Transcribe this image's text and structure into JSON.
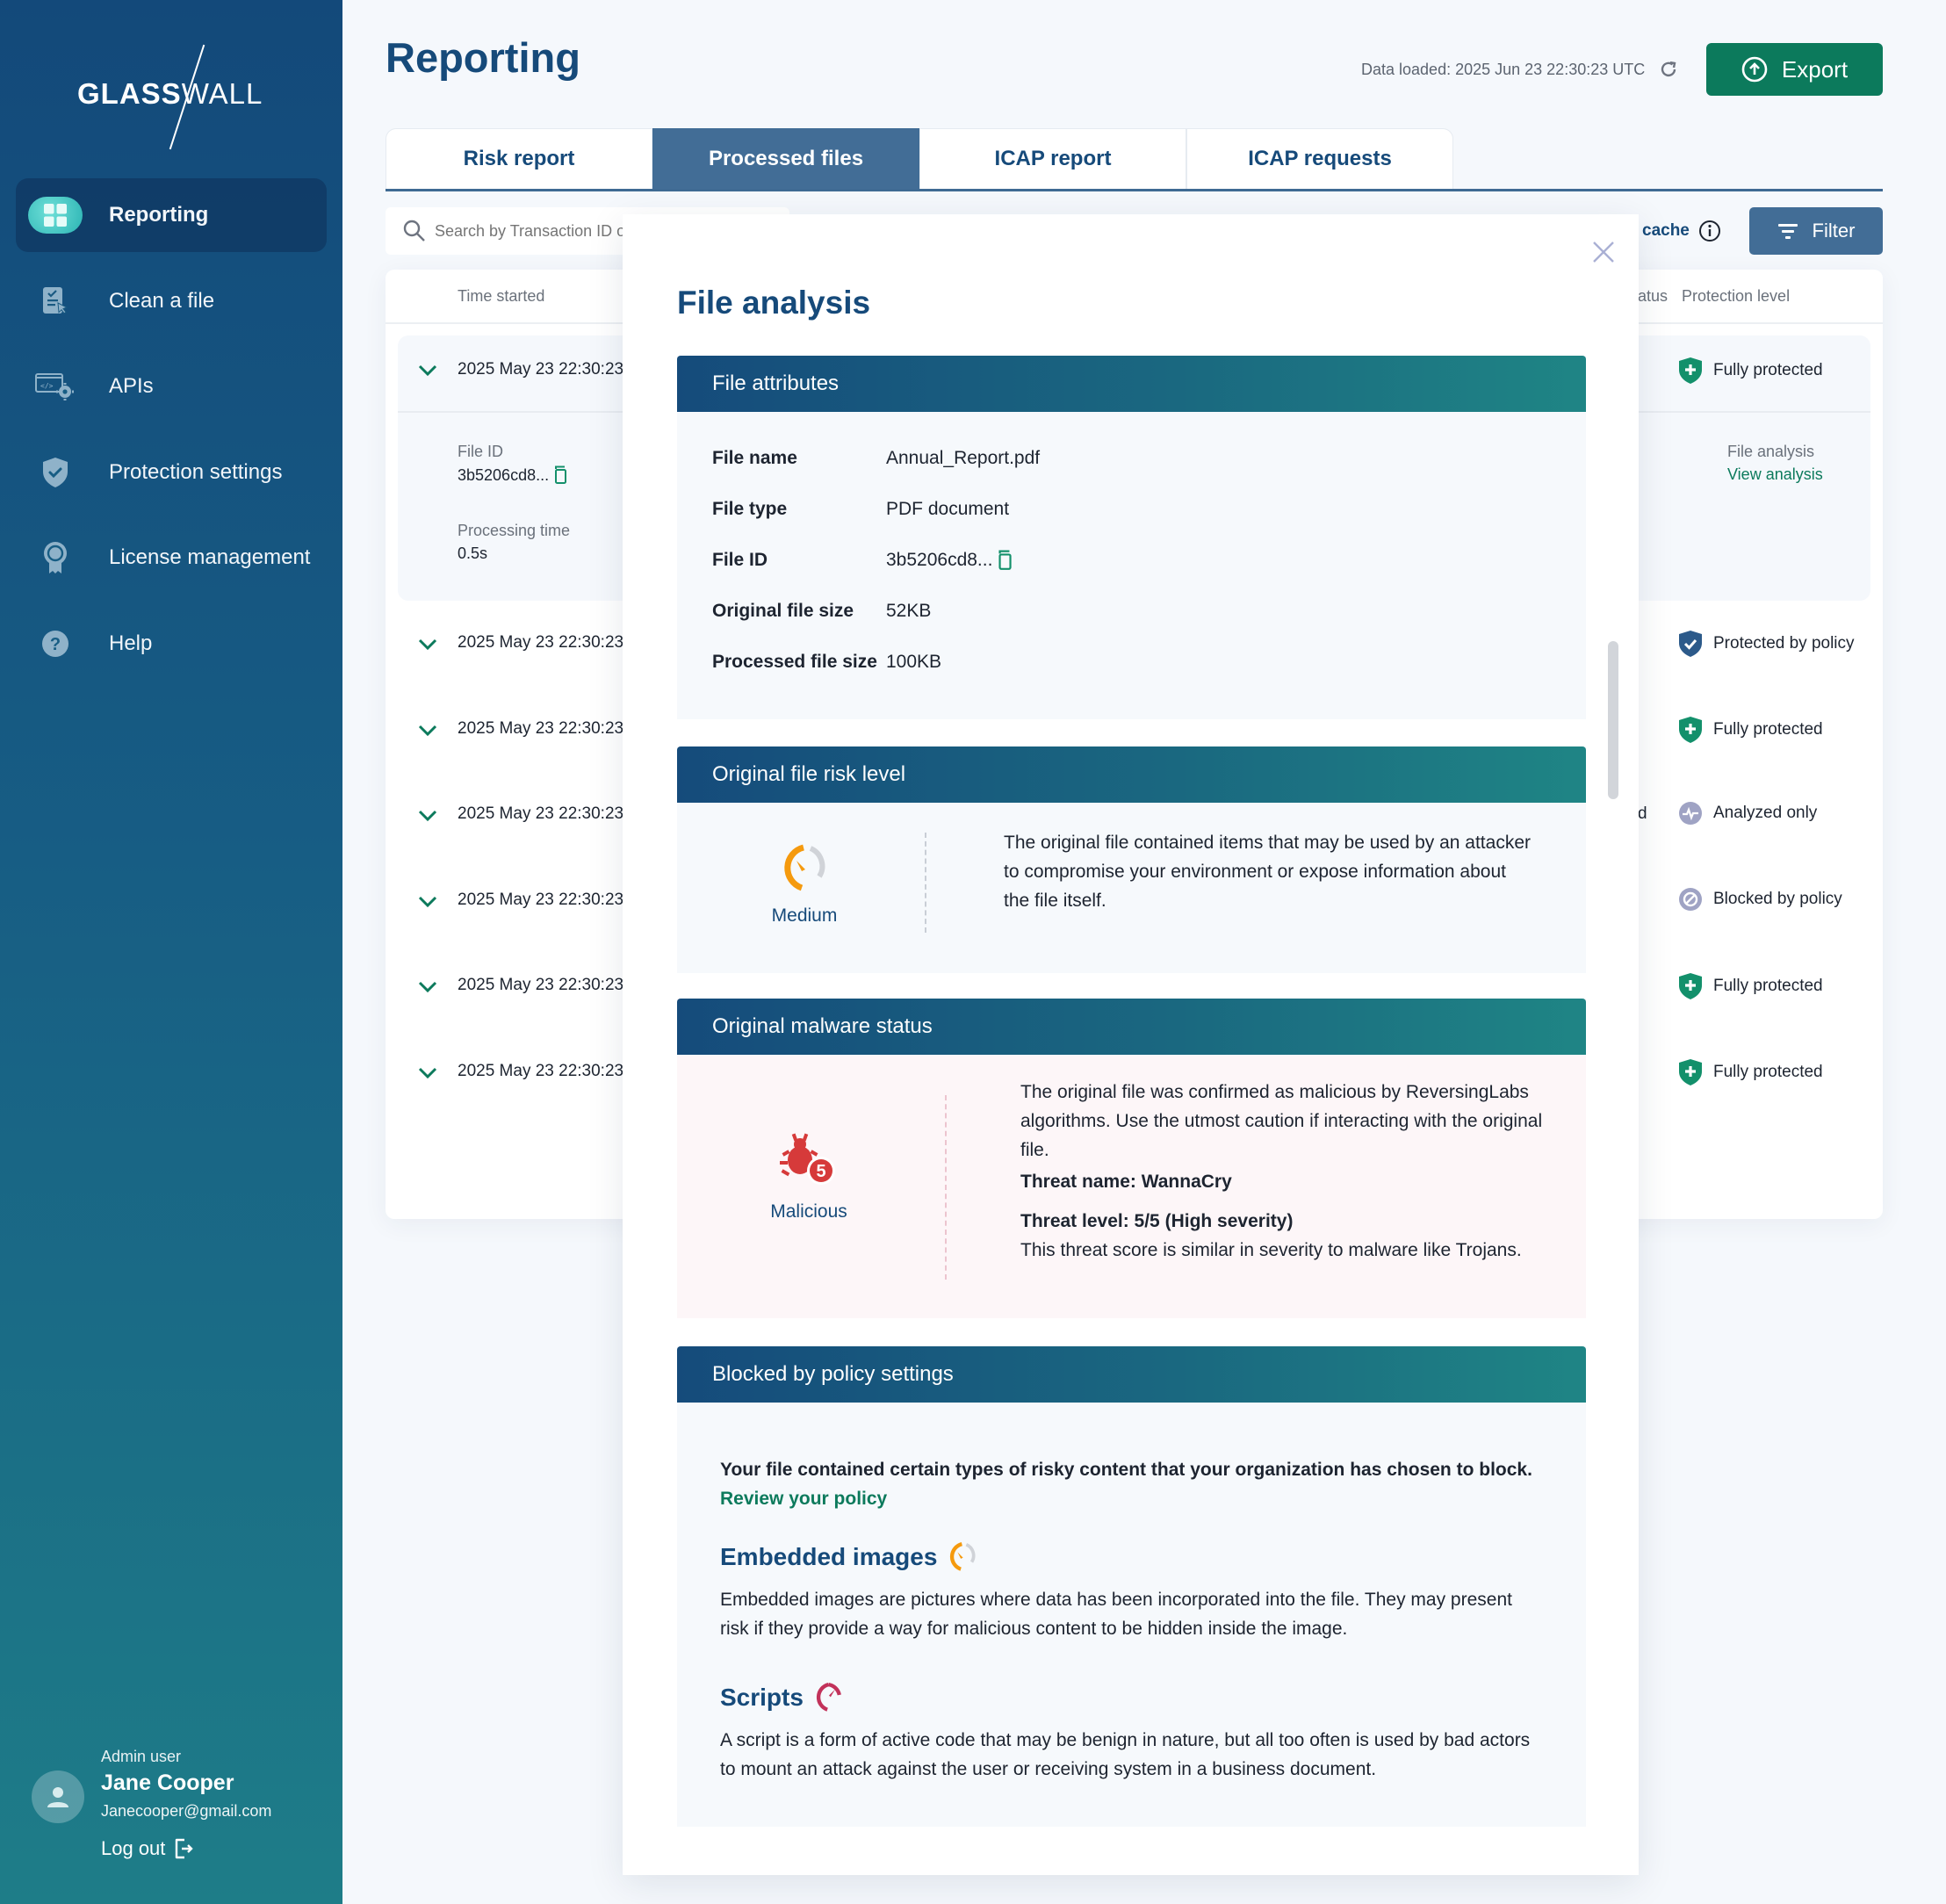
{
  "brand": {
    "name_bold": "GLASS",
    "name_light": "WALL"
  },
  "colors": {
    "primary": "#164a7a",
    "accent_green": "#0c7a5c",
    "tab_active": "#426d96",
    "medium_risk": "#f59a0e",
    "malicious": "#d63a3a",
    "high_risk": "#c2325a",
    "status_neutral": "#9fa3c4",
    "policy_blue": "#2c5a8a"
  },
  "sidebar": {
    "items": [
      {
        "label": "Reporting",
        "icon": "dashboard-grid-icon",
        "active": true
      },
      {
        "label": "Clean a file",
        "icon": "clean-file-icon",
        "active": false
      },
      {
        "label": "APIs",
        "icon": "api-settings-icon",
        "active": false
      },
      {
        "label": "Protection settings",
        "icon": "shield-check-icon",
        "active": false
      },
      {
        "label": "License management",
        "icon": "license-badge-icon",
        "active": false
      },
      {
        "label": "Help",
        "icon": "help-icon",
        "active": false
      }
    ],
    "user": {
      "role": "Admin user",
      "name": "Jane Cooper",
      "email": "Janecooper@gmail.com",
      "logout_label": "Log out"
    }
  },
  "header": {
    "title": "Reporting",
    "data_loaded": "Data loaded: 2025 Jun 23 22:30:23 UTC",
    "export_label": "Export"
  },
  "tabs": [
    {
      "label": "Risk report",
      "active": false
    },
    {
      "label": "Processed files",
      "active": true
    },
    {
      "label": "ICAP report",
      "active": false
    },
    {
      "label": "ICAP requests",
      "active": false
    }
  ],
  "toolbar": {
    "search_placeholder": "Search by Transaction ID o",
    "cache_label": "cache",
    "filter_label": "Filter"
  },
  "table": {
    "columns": {
      "time_started": "Time started",
      "status_partial": "atus",
      "protection_level": "Protection level"
    },
    "rows": [
      {
        "time": "2025 May 23 22:30:23",
        "protection": "Fully protected",
        "status_icon": "shield-plus-icon",
        "expanded": true
      },
      {
        "time": "2025 May 23 22:30:23",
        "protection": "Protected by policy",
        "status_icon": "shield-check-icon"
      },
      {
        "time": "2025 May 23 22:30:23",
        "protection": "Fully protected",
        "status_icon": "shield-plus-icon"
      },
      {
        "time": "2025 May 23 22:30:23",
        "protection": "Analyzed only",
        "status_icon": "pulse-icon",
        "status_partial": "d"
      },
      {
        "time": "2025 May 23 22:30:23",
        "protection": "Blocked by policy",
        "status_icon": "blocked-icon"
      },
      {
        "time": "2025 May 23 22:30:23",
        "protection": "Fully protected",
        "status_icon": "shield-plus-icon"
      },
      {
        "time": "2025 May 23 22:30:23",
        "protection": "Fully protected",
        "status_icon": "shield-plus-icon"
      }
    ],
    "expanded_details": {
      "file_id_label": "File ID",
      "file_id_value": "3b5206cd8...",
      "processing_time_label": "Processing time",
      "processing_time_value": "0.5s",
      "file_analysis_label": "File analysis",
      "view_analysis_link": "View analysis"
    }
  },
  "modal": {
    "title": "File analysis",
    "attributes": {
      "heading": "File attributes",
      "rows": [
        {
          "label": "File name",
          "value": "Annual_Report.pdf"
        },
        {
          "label": "File type",
          "value": "PDF document"
        },
        {
          "label": "File ID",
          "value": "3b5206cd8...",
          "copyable": true
        },
        {
          "label": "Original file size",
          "value": "52KB"
        },
        {
          "label": "Processed file size",
          "value": "100KB"
        }
      ]
    },
    "risk": {
      "heading": "Original file risk level",
      "level": "Medium",
      "description": "The original file contained items that may be used by an attacker to compromise your environment or expose information about the file itself."
    },
    "malware": {
      "heading": "Original malware status",
      "status": "Malicious",
      "severity_badge": "5",
      "description": "The original file was confirmed as malicious by ReversingLabs algorithms. Use the utmost caution if interacting with the original file.",
      "threat_name": "Threat name: WannaCry",
      "threat_level": "Threat level: 5/5 (High severity)",
      "threat_note": "This threat score is similar in severity to malware like Trojans."
    },
    "policy": {
      "heading": "Blocked by policy settings",
      "intro": "Your file contained certain types of risky content that your organization has chosen to block.",
      "review_link": "Review your policy",
      "items": [
        {
          "title": "Embedded images",
          "risk": "medium",
          "description": "Embedded images are pictures where data has been incorporated into the file. They may present risk if they provide a way for malicious content to be hidden inside the image."
        },
        {
          "title": "Scripts",
          "risk": "high",
          "description": "A script is a form of active code that may be benign in nature, but all too often is used by bad actors to mount an attack against the user or receiving system in a business document."
        }
      ]
    }
  }
}
